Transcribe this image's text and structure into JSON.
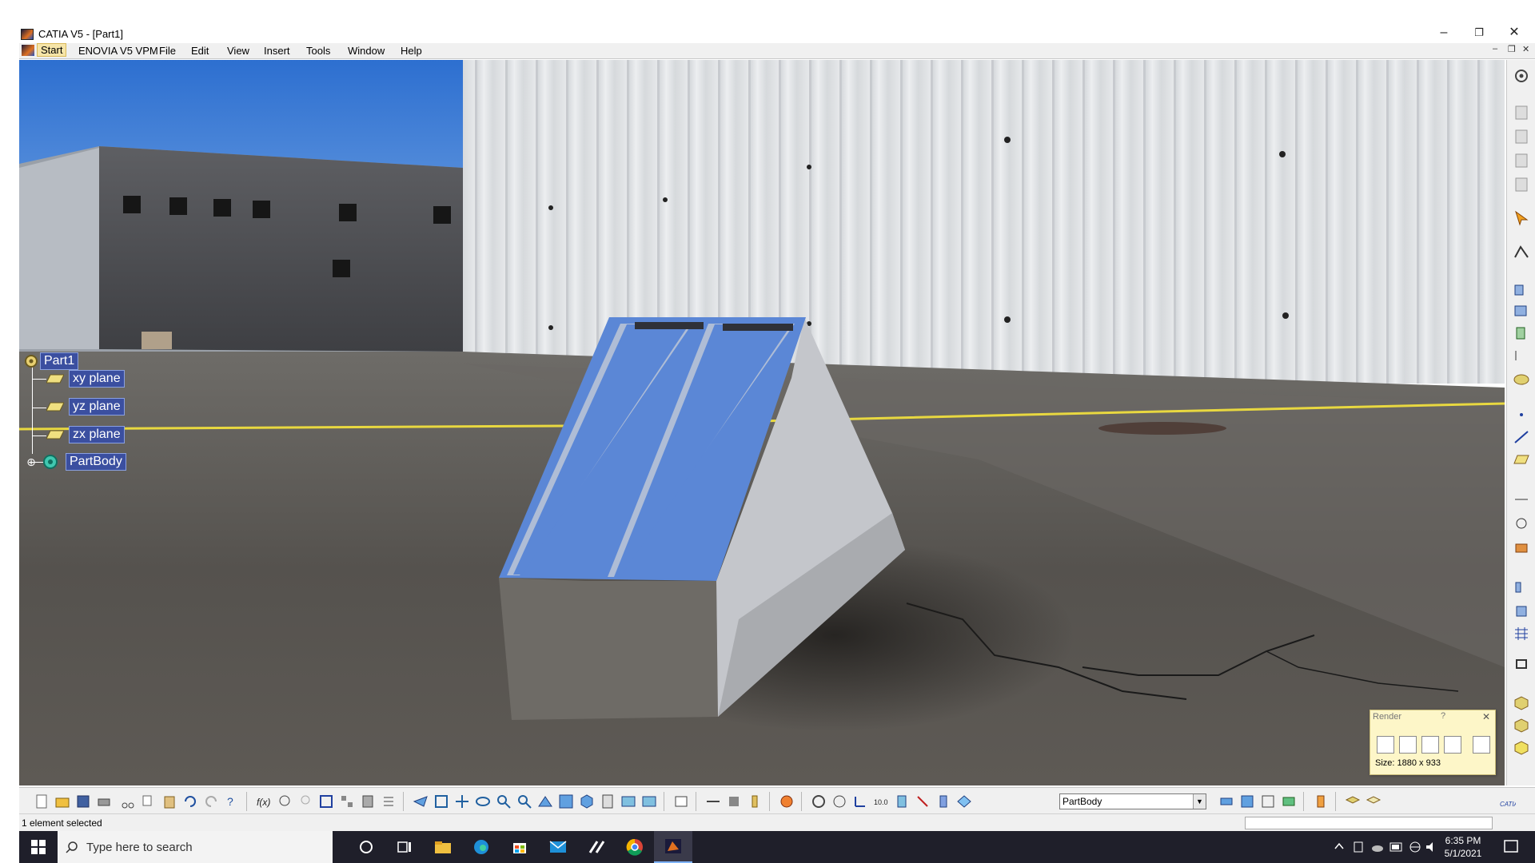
{
  "window": {
    "title": "CATIA V5 - [Part1]",
    "minimize_icon": "minimize-icon",
    "restore_icon": "restore-icon",
    "close_icon": "close-icon"
  },
  "menu": {
    "items": [
      "Start",
      "ENOVIA V5 VPM",
      "File",
      "Edit",
      "View",
      "Insert",
      "Tools",
      "Window",
      "Help"
    ]
  },
  "tree": {
    "root": "Part1",
    "children": [
      "xy plane",
      "yz plane",
      "zx plane",
      "PartBody"
    ]
  },
  "render_dialog": {
    "title": "Render",
    "help": "?",
    "size_label": "Size: 1880 x 933"
  },
  "toolbar": {
    "body_select_value": "PartBody"
  },
  "status": {
    "message": "1 element selected"
  },
  "taskbar": {
    "search_placeholder": "Type here to search",
    "time": "6:35 PM",
    "date": "5/1/2021"
  },
  "colors": {
    "tree_highlight": "#3b4fa0",
    "solid_top": "#5b87d6",
    "solid_side": "#c4c6cb",
    "solid_front": "#6e6b66",
    "taskbar": "#1f1f2a"
  }
}
